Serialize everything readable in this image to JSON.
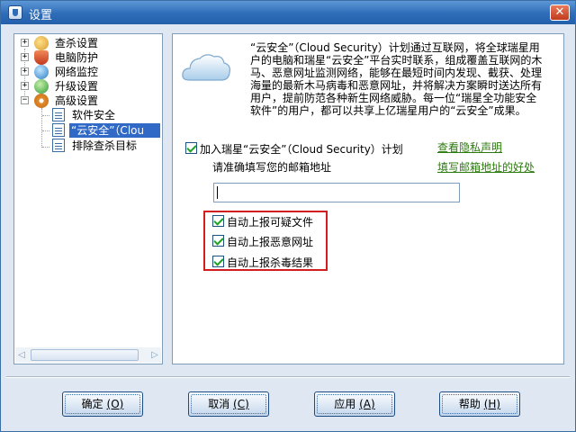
{
  "window": {
    "title": "设置",
    "close_glyph": "✕",
    "icon": "app-shield-icon"
  },
  "tree": {
    "items": [
      {
        "label": "查杀设置",
        "icon": "scan-icon",
        "color": "#d89a2a",
        "expander": "+"
      },
      {
        "label": "电脑防护",
        "icon": "shield-icon",
        "color": "#d04a2a",
        "expander": "+"
      },
      {
        "label": "网络监控",
        "icon": "globe-icon",
        "color": "#3a8ed0",
        "expander": "+"
      },
      {
        "label": "升级设置",
        "icon": "update-icon",
        "color": "#3aa34a",
        "expander": "+"
      },
      {
        "label": "高级设置",
        "icon": "gear-icon",
        "color": "#e08a2a",
        "expander": "−"
      }
    ],
    "children": [
      {
        "label": "软件安全"
      },
      {
        "label": "“云安全”（Clou"
      },
      {
        "label": "排除查杀目标"
      }
    ],
    "scroll_left_glyph": "◁",
    "scroll_right_glyph": "▷"
  },
  "content": {
    "intro": "“云安全”（Cloud Security）计划通过互联网，将全球瑞星用户的电脑和瑞星“云安全”平台实时联系，组成覆盖互联网的木马、恶意网址监测网络，能够在最短时间内发现、截获、处理海量的最新木马病毒和恶意网址，并将解决方案瞬时送达所有用户，提前防范各种新生网络威胁。每一位“瑞星全功能安全软件”的用户，都可以共享上亿瑞星用户的“云安全”成果。",
    "join_label": "加入瑞星“云安全”（Cloud Security）计划",
    "privacy_link": "查看隐私声明",
    "email_prompt": "请准确填写您的邮箱地址",
    "email_benefit_link": "填写邮箱地址的好处",
    "email_value": "",
    "options": [
      {
        "label": "自动上报可疑文件",
        "checked": true
      },
      {
        "label": "自动上报恶意网址",
        "checked": true
      },
      {
        "label": "自动上报杀毒结果",
        "checked": true
      }
    ]
  },
  "buttons": {
    "ok": {
      "label": "确定",
      "mnemonic": "(O)"
    },
    "cancel": {
      "label": "取消",
      "mnemonic": "(C)"
    },
    "apply": {
      "label": "应用",
      "mnemonic": "(A)"
    },
    "help": {
      "label": "帮助",
      "mnemonic": "(H)"
    }
  }
}
